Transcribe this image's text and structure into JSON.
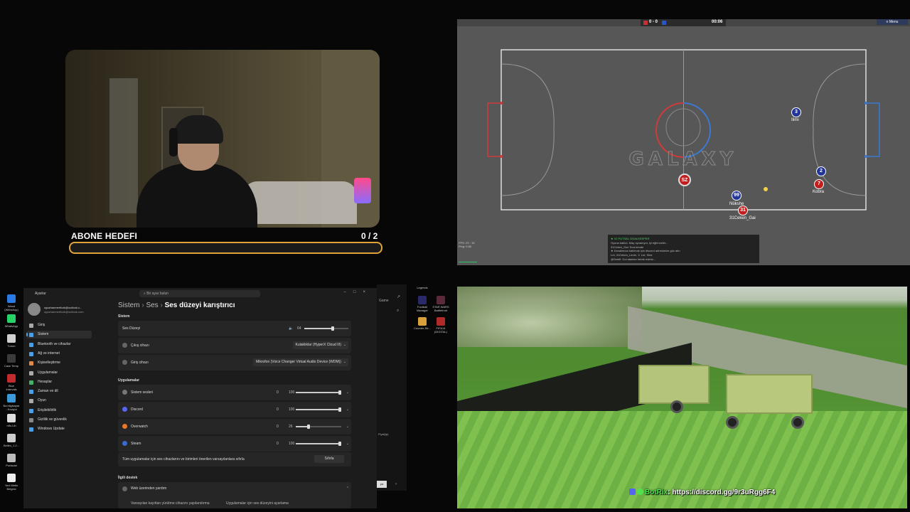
{
  "webcam": {
    "goal_label": "ABONE HEDEFI",
    "goal_count": "0  / 2",
    "progress": 0
  },
  "game": {
    "score": "0 - 0",
    "time": "00:06",
    "menu_label": "Menu",
    "center_logo": "GALAXY",
    "players": [
      {
        "number": "3",
        "team": "blue",
        "name": "Ilimi"
      },
      {
        "number": "2",
        "team": "blue",
        "name": ""
      },
      {
        "number": "7",
        "team": "red",
        "name": "Kobra"
      },
      {
        "number": "SZ",
        "team": "red",
        "name": ""
      },
      {
        "number": "99",
        "team": "blue",
        "name": "Nükshe"
      },
      {
        "number": "31",
        "team": "red",
        "name": "31Ceken_Gai"
      }
    ],
    "fps": "FPS: 23 · 15",
    "fps_sub": "Ping: 0.85",
    "chat": [
      "★ V2 FUTSAL GOALKEEPER",
      "Oyuna katıldı. Maç oynanıyor, iyi eğlenceler...",
      "31Ceken_Gai: Sıra bende",
      "★ Kanalımıza katılmak için discord adresimize göz atın",
      "Lnt, 31Ceken_Lenin, ♕ Lnt, Sine",
      "@Sentil: Gol atanları tebrik ederiz..."
    ],
    "colors": {
      "red_team": "#c21e1e",
      "blue_team": "#21349a",
      "field": "#575757"
    }
  },
  "desktop_icons": [
    {
      "label": "Wand (Webshop)",
      "color": "#2c7be5"
    },
    {
      "label": "WhatsApp",
      "color": "#25d366"
    },
    {
      "label": "Tomm",
      "color": "#d0d0d0"
    },
    {
      "label": "Case Temp",
      "color": "#3a3a3a"
    },
    {
      "label": "Blue Intervals",
      "color": "#c22b2b"
    },
    {
      "label": "Ba bilgisayar - Kısayol",
      "color": "#3c9ad8"
    },
    {
      "label": "ntfo.Lib",
      "color": "#ddd"
    },
    {
      "label": "Bellim_1.2...",
      "color": "#ccc"
    },
    {
      "label": "Portacist",
      "color": "#bbb"
    },
    {
      "label": "Yeni Metin Belgesi",
      "color": "#eee"
    }
  ],
  "settings": {
    "window_title": "Ayarlar",
    "search_placeholder": "Bir ayar bulun",
    "profile_name": "oguzhanmertturk@outlook.c...",
    "profile_email": "oguzhanmertturk@outlook.com",
    "nav": [
      {
        "label": "Giriş",
        "color": "#aaa"
      },
      {
        "label": "Sistem",
        "color": "#4aa0e8",
        "active": true
      },
      {
        "label": "Bluetooth ve cihazlar",
        "color": "#4aa0e8"
      },
      {
        "label": "Ağ ve internet",
        "color": "#4aa0e8"
      },
      {
        "label": "Kişiselleştirme",
        "color": "#e08a4a"
      },
      {
        "label": "Uygulamalar",
        "color": "#aaa"
      },
      {
        "label": "Hesaplar",
        "color": "#43b36a"
      },
      {
        "label": "Zaman ve dil",
        "color": "#4aa0e8"
      },
      {
        "label": "Oyun",
        "color": "#aaa"
      },
      {
        "label": "Erişilebilirlik",
        "color": "#4aa0e8"
      },
      {
        "label": "Gizlilik ve güvenlik",
        "color": "#888"
      },
      {
        "label": "Windows Update",
        "color": "#4aa0e8"
      }
    ],
    "breadcrumb": [
      "Sistem",
      "Ses",
      "Ses düzeyi karıştırıcı"
    ],
    "section_system": "Sistem",
    "system_rows": {
      "volume_label": "Ses Düzeyi",
      "volume_value": "64",
      "output_label": "Çıkış cihazı",
      "output_value": "Kulaklıklar (HyperX Cloud III)",
      "input_label": "Giriş cihazı",
      "input_value": "Mikrofon (Voice Changer Virtual Audio Device (WDM))"
    },
    "section_apps": "Uygulamalar",
    "apps": [
      {
        "name": "Sistem sesleri",
        "balance": "0",
        "value": "100",
        "level": 1.0
      },
      {
        "name": "Discord",
        "balance": "0",
        "value": "100",
        "level": 1.0
      },
      {
        "name": "Overwatch",
        "balance": "0",
        "value": "26",
        "level": 0.26
      },
      {
        "name": "Steam",
        "balance": "0",
        "value": "100",
        "level": 1.0
      }
    ],
    "reset_label": "Tüm uygulamalar için ses cihazlarını ve birimleri önerilen varsayılanlara sıfırla",
    "reset_button": "Sıfırla",
    "section_help": "İlgili destek",
    "help_row": "Web üzerinden yardım",
    "help_links": [
      "Varsayılan kayıttan yürütme cihazını yapılandırma",
      "Uygulamalar için ses düzeyini ayarlama"
    ]
  },
  "mid_desktop": {
    "items": [
      "Legends",
      "Football Manager",
      "STAR WARS Battlefront",
      "Counter-Str...",
      "FIFA14 (DIGITAL)"
    ],
    "launcher_label": "Game",
    "side_texts": [
      "Fiyat(ip)",
      "pa"
    ]
  },
  "overlay": {
    "bot_name": "BotRix",
    "discord_text": ": https://discord.gg/9r3uRgg6F4"
  }
}
